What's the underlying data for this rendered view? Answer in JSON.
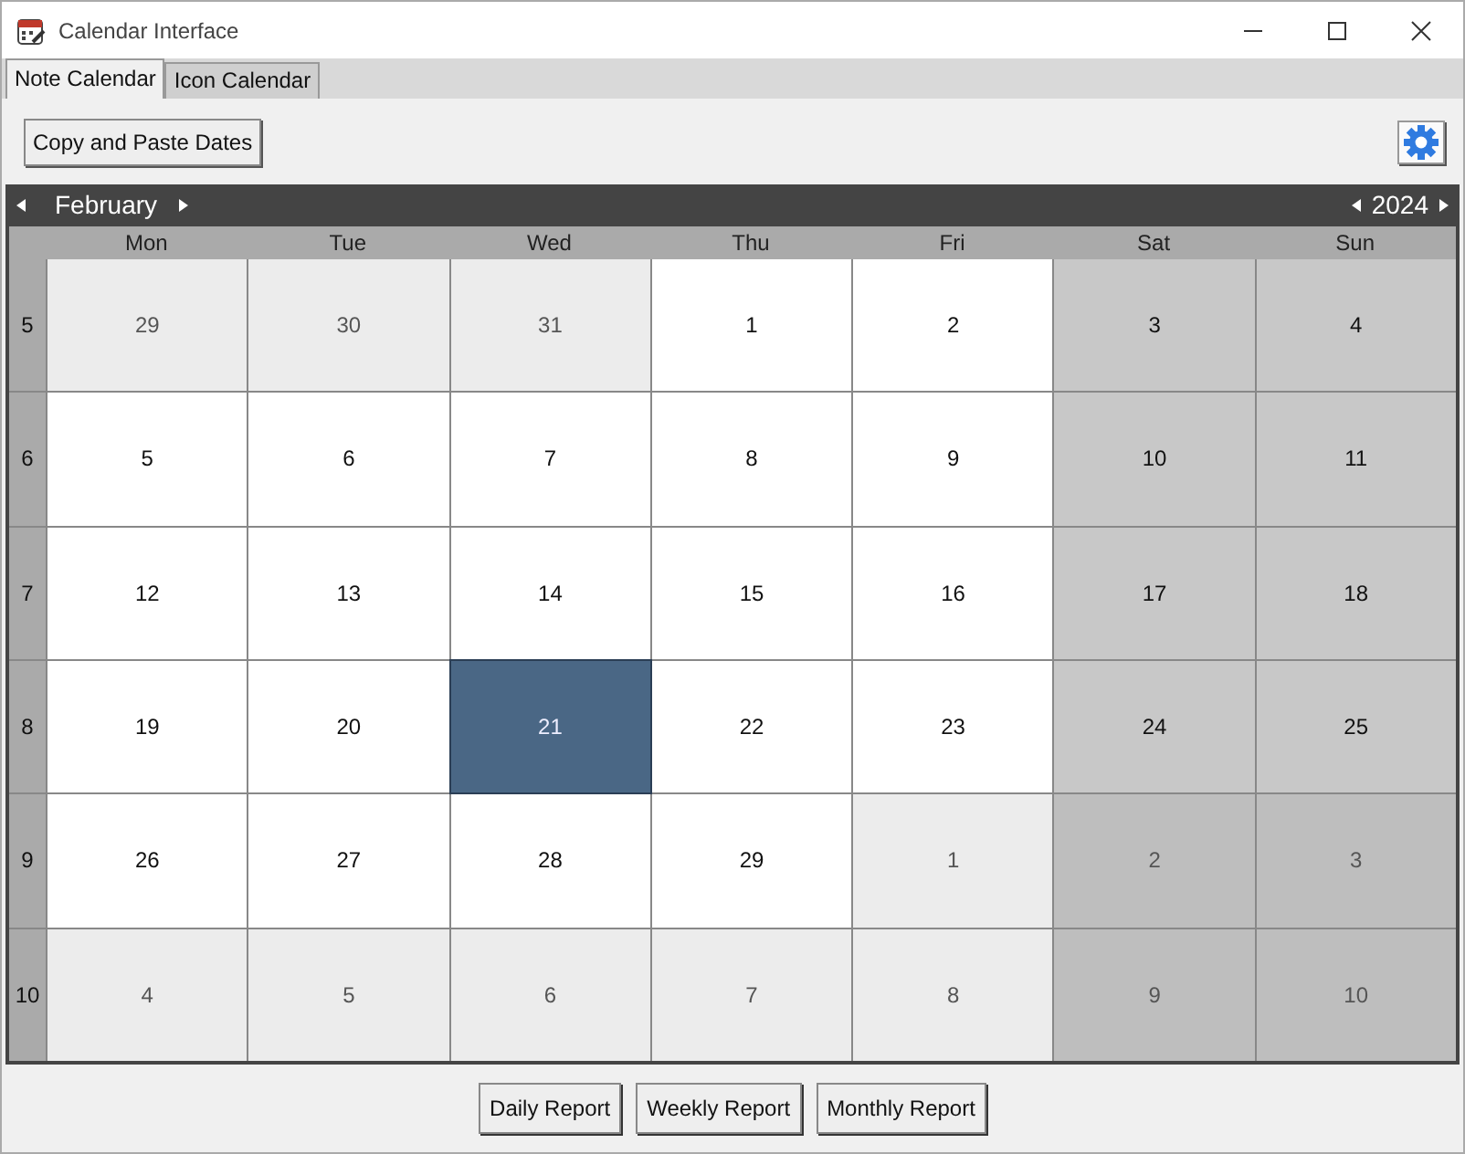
{
  "window": {
    "title": "Calendar Interface"
  },
  "tabs": [
    {
      "label": "Note Calendar",
      "selected": true
    },
    {
      "label": "Icon Calendar",
      "selected": false
    }
  ],
  "toolbar": {
    "button": "Copy and Paste Dates"
  },
  "calendar": {
    "month": "February",
    "year": "2024",
    "day_headers": [
      {
        "label": "Mon",
        "weekend": false
      },
      {
        "label": "Tue",
        "weekend": false
      },
      {
        "label": "Wed",
        "weekend": false
      },
      {
        "label": "Thu",
        "weekend": false
      },
      {
        "label": "Fri",
        "weekend": false
      },
      {
        "label": "Sat",
        "weekend": true
      },
      {
        "label": "Sun",
        "weekend": true
      }
    ],
    "weeks": [
      {
        "number": "5",
        "days": [
          {
            "day": "29",
            "in_month": false,
            "selected": false
          },
          {
            "day": "30",
            "in_month": false,
            "selected": false
          },
          {
            "day": "31",
            "in_month": false,
            "selected": false
          },
          {
            "day": "1",
            "in_month": true,
            "selected": false
          },
          {
            "day": "2",
            "in_month": true,
            "selected": false
          },
          {
            "day": "3",
            "in_month": true,
            "selected": false
          },
          {
            "day": "4",
            "in_month": true,
            "selected": false
          }
        ]
      },
      {
        "number": "6",
        "days": [
          {
            "day": "5",
            "in_month": true,
            "selected": false
          },
          {
            "day": "6",
            "in_month": true,
            "selected": false
          },
          {
            "day": "7",
            "in_month": true,
            "selected": false
          },
          {
            "day": "8",
            "in_month": true,
            "selected": false
          },
          {
            "day": "9",
            "in_month": true,
            "selected": false
          },
          {
            "day": "10",
            "in_month": true,
            "selected": false
          },
          {
            "day": "11",
            "in_month": true,
            "selected": false
          }
        ]
      },
      {
        "number": "7",
        "days": [
          {
            "day": "12",
            "in_month": true,
            "selected": false
          },
          {
            "day": "13",
            "in_month": true,
            "selected": false
          },
          {
            "day": "14",
            "in_month": true,
            "selected": false
          },
          {
            "day": "15",
            "in_month": true,
            "selected": false
          },
          {
            "day": "16",
            "in_month": true,
            "selected": false
          },
          {
            "day": "17",
            "in_month": true,
            "selected": false
          },
          {
            "day": "18",
            "in_month": true,
            "selected": false
          }
        ]
      },
      {
        "number": "8",
        "days": [
          {
            "day": "19",
            "in_month": true,
            "selected": false
          },
          {
            "day": "20",
            "in_month": true,
            "selected": false
          },
          {
            "day": "21",
            "in_month": true,
            "selected": true
          },
          {
            "day": "22",
            "in_month": true,
            "selected": false
          },
          {
            "day": "23",
            "in_month": true,
            "selected": false
          },
          {
            "day": "24",
            "in_month": true,
            "selected": false
          },
          {
            "day": "25",
            "in_month": true,
            "selected": false
          }
        ]
      },
      {
        "number": "9",
        "days": [
          {
            "day": "26",
            "in_month": true,
            "selected": false
          },
          {
            "day": "27",
            "in_month": true,
            "selected": false
          },
          {
            "day": "28",
            "in_month": true,
            "selected": false
          },
          {
            "day": "29",
            "in_month": true,
            "selected": false
          },
          {
            "day": "1",
            "in_month": false,
            "selected": false
          },
          {
            "day": "2",
            "in_month": false,
            "selected": false
          },
          {
            "day": "3",
            "in_month": false,
            "selected": false
          }
        ]
      },
      {
        "number": "10",
        "days": [
          {
            "day": "4",
            "in_month": false,
            "selected": false
          },
          {
            "day": "5",
            "in_month": false,
            "selected": false
          },
          {
            "day": "6",
            "in_month": false,
            "selected": false
          },
          {
            "day": "7",
            "in_month": false,
            "selected": false
          },
          {
            "day": "8",
            "in_month": false,
            "selected": false
          },
          {
            "day": "9",
            "in_month": false,
            "selected": false
          },
          {
            "day": "10",
            "in_month": false,
            "selected": false
          }
        ]
      }
    ]
  },
  "footer_buttons": [
    "Daily Report",
    "Weekly Report",
    "Monthly Report"
  ]
}
